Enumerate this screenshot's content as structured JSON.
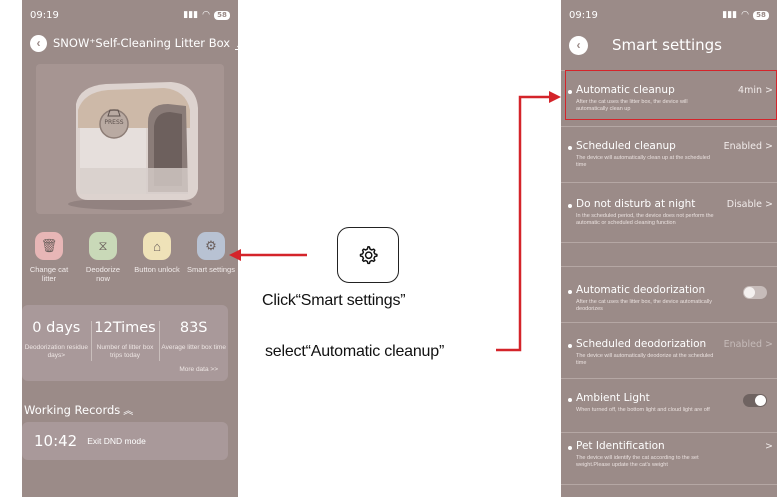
{
  "left_phone": {
    "status_time": "09:19",
    "battery": "58",
    "device_title": "SNOW⁺Self-Cleaning Litter Box",
    "device_badge": "PRESS",
    "actions": [
      {
        "label": "Change cat litter",
        "icon": "trash-icon",
        "color": "#e7b6b6"
      },
      {
        "label": "Deodorize now",
        "icon": "deodorize-icon",
        "color": "#c9d9b8"
      },
      {
        "label": "Button unlock",
        "icon": "unlock-icon",
        "color": "#efe2b8"
      },
      {
        "label": "Smart settings",
        "icon": "gear-icon",
        "color": "#b8c2d3"
      }
    ],
    "stats": [
      {
        "value": "0 days",
        "desc": "Deodorization residue days>"
      },
      {
        "value": "12Times",
        "desc": "Number of litter box trips today"
      },
      {
        "value": "83S",
        "desc": "Average litter box time"
      }
    ],
    "more_data": "More data >>",
    "records_title": "Working Records",
    "record": {
      "time": "10:42",
      "message": "Exit DND mode"
    }
  },
  "instructions": {
    "step1": "Click“Smart settings”",
    "step2": "select“Automatic cleanup”"
  },
  "right_phone": {
    "status_time": "09:19",
    "battery": "58",
    "title": "Smart settings",
    "settings": [
      {
        "title": "Automatic cleanup",
        "desc": "After the cat uses the litter box, the device will automatically clean up",
        "value": "4min >"
      },
      {
        "title": "Scheduled cleanup",
        "desc": "The device will automatically clean up at the scheduled time",
        "value": "Enabled >"
      },
      {
        "title": "Do not disturb at night",
        "desc": "In the scheduled period, the device does not perform the automatic or scheduled cleaning function",
        "value": "Disable >"
      },
      {
        "title": "Automatic deodorization",
        "desc": "After the cat uses the litter box, the device automatically deodorizes",
        "toggle": "off"
      },
      {
        "title": "Scheduled deodorization",
        "desc": "The device will automatically deodorize at the scheduled time",
        "value": "Enabled >"
      },
      {
        "title": "Ambient Light",
        "desc": "When turned off, the bottom light and cloud light are off",
        "toggle": "on"
      },
      {
        "title": "Pet Identification",
        "desc": "The device will identify the cat according to the set weight.Please update the cat's weight",
        "value": ">"
      }
    ]
  },
  "colors": {
    "screen_bg": "#9b8b88",
    "annotation_red": "#d4242a"
  }
}
